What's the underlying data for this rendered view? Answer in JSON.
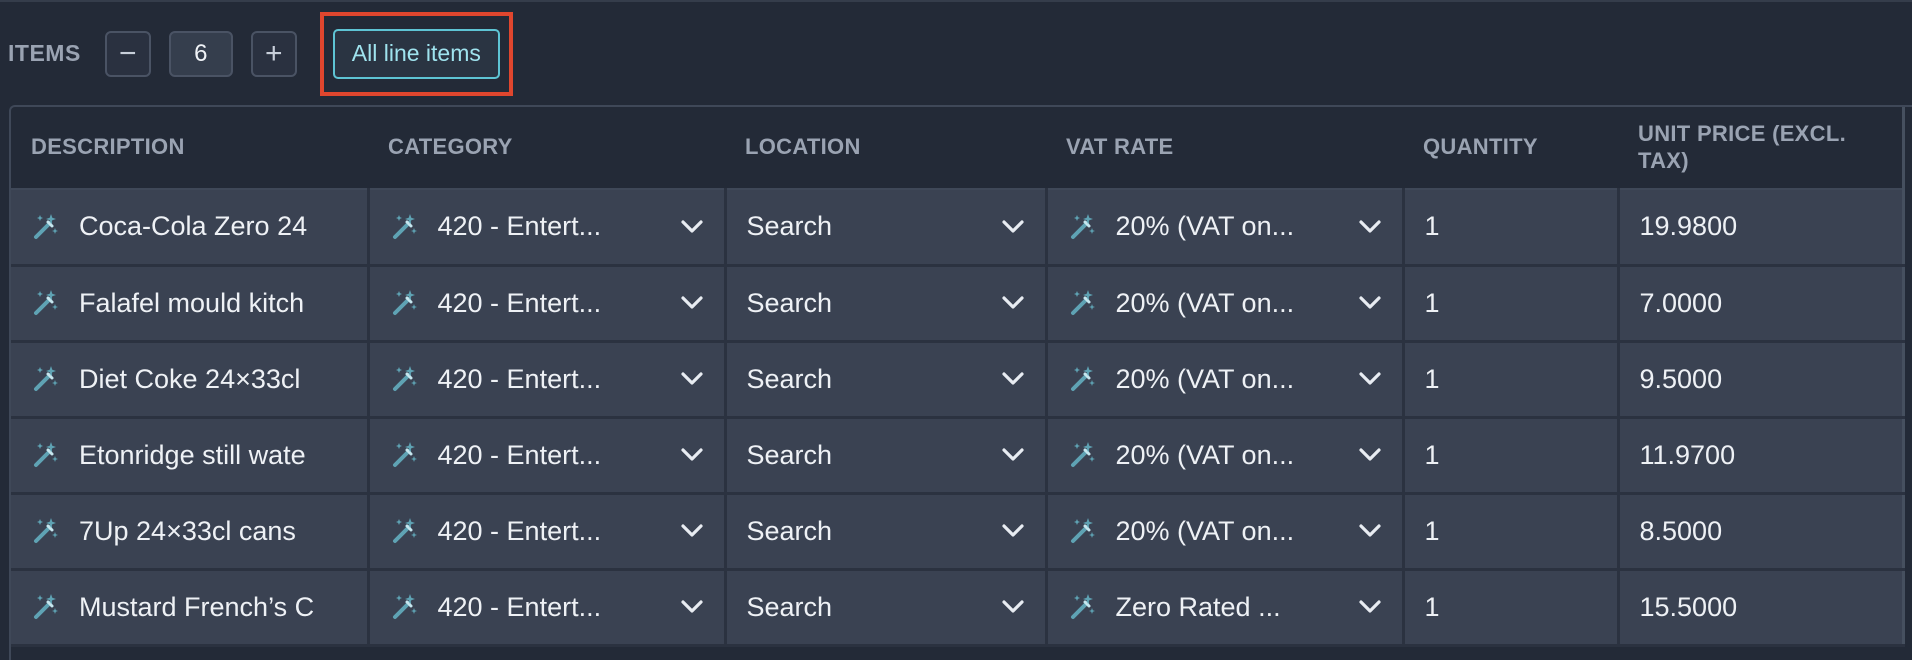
{
  "toolbar": {
    "items_label": "ITEMS",
    "decrement_symbol": "−",
    "count": "6",
    "increment_symbol": "+",
    "all_line_items_label": "All line items"
  },
  "colors": {
    "background": "#232a37",
    "cell_background": "#3a4252",
    "accent_teal": "#5ec4d4",
    "highlight_red": "#e0462e",
    "wand_icon": "#5fa3b4"
  },
  "table": {
    "headers": {
      "description": "DESCRIPTION",
      "category": "CATEGORY",
      "location": "LOCATION",
      "vat_rate": "VAT RATE",
      "quantity": "QUANTITY",
      "unit_price": "UNIT PRICE (EXCL. TAX)"
    },
    "rows": [
      {
        "description": "Coca-Cola Zero 24",
        "category": "420 - Entert...",
        "location": "Search",
        "vat_rate": "20% (VAT on...",
        "quantity": "1",
        "unit_price": "19.9800"
      },
      {
        "description": "Falafel mould kitch",
        "category": "420 - Entert...",
        "location": "Search",
        "vat_rate": "20% (VAT on...",
        "quantity": "1",
        "unit_price": "7.0000"
      },
      {
        "description": "Diet Coke 24×33cl",
        "category": "420 - Entert...",
        "location": "Search",
        "vat_rate": "20% (VAT on...",
        "quantity": "1",
        "unit_price": "9.5000"
      },
      {
        "description": "Etonridge still wate",
        "category": "420 - Entert...",
        "location": "Search",
        "vat_rate": "20% (VAT on...",
        "quantity": "1",
        "unit_price": "11.9700"
      },
      {
        "description": "7Up 24×33cl cans",
        "category": "420 - Entert...",
        "location": "Search",
        "vat_rate": "20% (VAT on...",
        "quantity": "1",
        "unit_price": "8.5000"
      },
      {
        "description": "Mustard French’s C",
        "category": "420 - Entert...",
        "location": "Search",
        "vat_rate": "Zero Rated ...",
        "quantity": "1",
        "unit_price": "15.5000"
      }
    ]
  }
}
